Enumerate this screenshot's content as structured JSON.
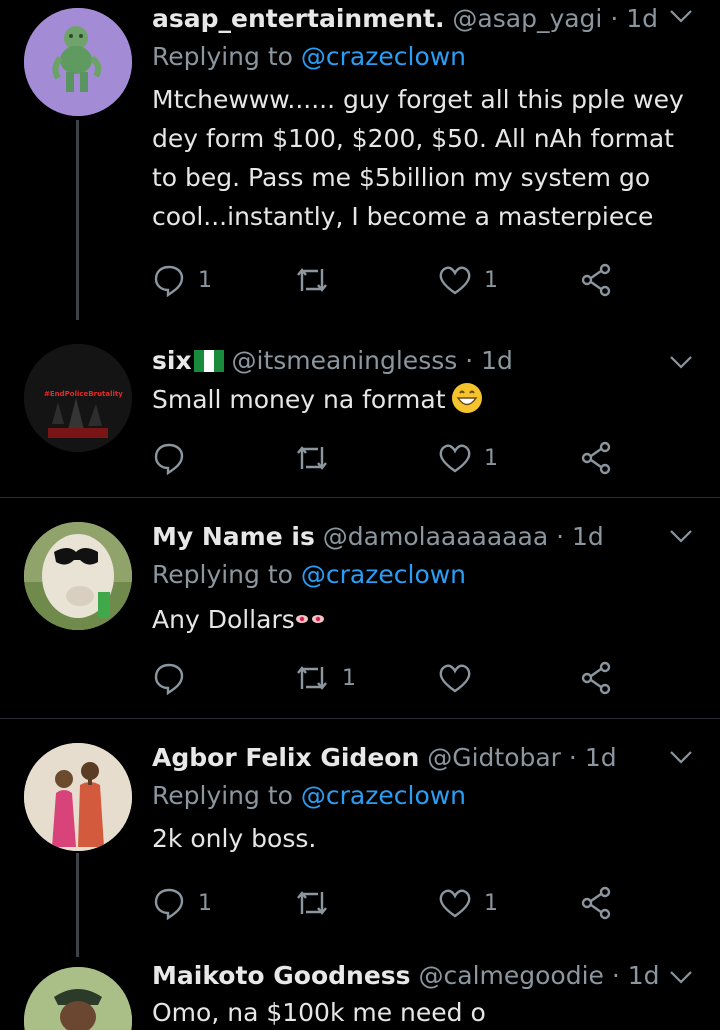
{
  "tweets": [
    {
      "name": "asap_entertainment.",
      "handle": "@asap_yagi",
      "time": "· 1d",
      "reply_prefix": "Replying to",
      "reply_to": "@crazeclown",
      "text": "Mtchewww...... guy forget all this pple wey dey form $100, $200, $50. All nAh format to beg. Pass me $5billion my system go cool...instantly, I become a masterpiece",
      "reply_count": "1",
      "retweet_count": "",
      "like_count": "1"
    },
    {
      "name": "six",
      "handle": "@itsmeaninglesss",
      "time": "· 1d",
      "text": "Small money na format",
      "avatar_caption": "#EndPoliceBrutality",
      "reply_count": "",
      "retweet_count": "",
      "like_count": "1"
    },
    {
      "name": "My Name is",
      "handle": "@damolaaaaaaaa",
      "time": "· 1d",
      "reply_prefix": "Replying to",
      "reply_to": "@crazeclown",
      "text": "Any Dollars",
      "reply_count": "",
      "retweet_count": "1",
      "like_count": ""
    },
    {
      "name": "Agbor Felix Gideon",
      "handle": "@Gidtobar",
      "time": "· 1d",
      "reply_prefix": "Replying to",
      "reply_to": "@crazeclown",
      "text": "2k only boss.",
      "reply_count": "1",
      "retweet_count": "",
      "like_count": "1"
    },
    {
      "name": "Maikoto Goodness",
      "handle": "@calmegoodie",
      "time": "· 1d",
      "text": "Omo, na $100k me need o"
    }
  ],
  "colors": {
    "background": "#000000",
    "link": "#2a9df4",
    "muted": "#8b969e",
    "text": "#e6e6e6"
  },
  "icons": [
    "reply-icon",
    "retweet-icon",
    "like-icon",
    "share-icon",
    "chevron-down-icon"
  ]
}
